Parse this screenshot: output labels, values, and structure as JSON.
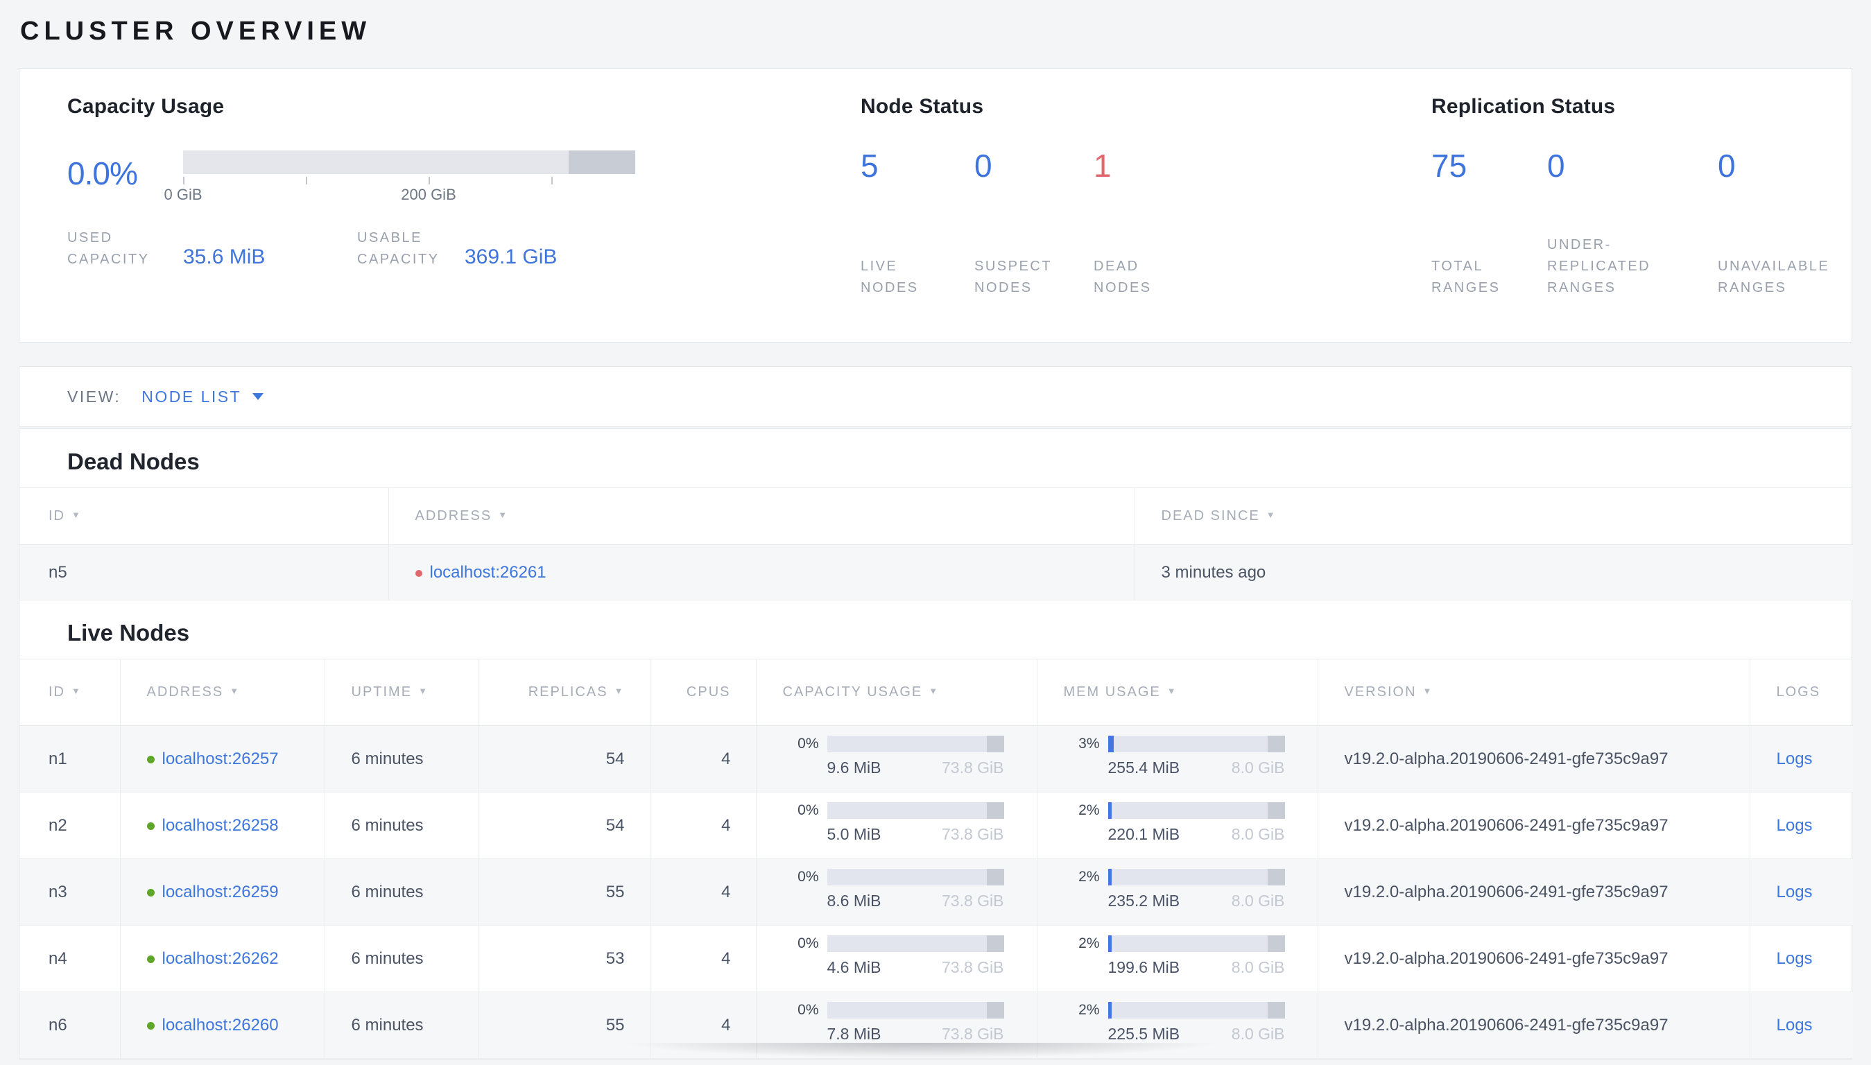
{
  "colors": {
    "accent_blue": "#3e74db",
    "link_blue": "#3d77de",
    "danger_red": "#e0686d",
    "live_green": "#5fa528",
    "bar_track": "#e2e5ee",
    "bar_dark": "#c8ccd4",
    "bar_fill": "#4477e4"
  },
  "page": {
    "title": "CLUSTER OVERVIEW"
  },
  "summary": {
    "capacity": {
      "title": "Capacity Usage",
      "percent": "0.0%",
      "axis_ticks": [
        "0 GiB",
        "200 GiB"
      ],
      "stats": [
        {
          "label": "USED CAPACITY",
          "value": "35.6 MiB"
        },
        {
          "label": "USABLE CAPACITY",
          "value": "369.1 GiB"
        }
      ]
    },
    "node_status": {
      "title": "Node Status",
      "metrics": [
        {
          "value": "5",
          "label": "LIVE NODES",
          "color": "blue"
        },
        {
          "value": "0",
          "label": "SUSPECT NODES",
          "color": "blue"
        },
        {
          "value": "1",
          "label": "DEAD NODES",
          "color": "red"
        }
      ]
    },
    "replication": {
      "title": "Replication Status",
      "metrics": [
        {
          "value": "75",
          "label": "TOTAL RANGES",
          "color": "blue"
        },
        {
          "value": "0",
          "label": "UNDER-REPLICATED RANGES",
          "color": "blue"
        },
        {
          "value": "0",
          "label": "UNAVAILABLE RANGES",
          "color": "blue"
        }
      ]
    }
  },
  "view_bar": {
    "label": "VIEW:",
    "selected": "NODE LIST"
  },
  "dead_nodes": {
    "heading": "Dead Nodes",
    "columns": [
      {
        "label": "ID",
        "sortable": true
      },
      {
        "label": "ADDRESS",
        "sortable": true
      },
      {
        "label": "DEAD SINCE",
        "sortable": true
      }
    ],
    "rows": [
      {
        "id": "n5",
        "address": "localhost:26261",
        "dead_since": "3 minutes ago"
      }
    ]
  },
  "live_nodes": {
    "heading": "Live Nodes",
    "logs_label": "Logs",
    "columns": [
      {
        "label": "ID",
        "sortable": true,
        "align": "left"
      },
      {
        "label": "ADDRESS",
        "sortable": true,
        "align": "left"
      },
      {
        "label": "UPTIME",
        "sortable": true,
        "align": "left"
      },
      {
        "label": "REPLICAS",
        "sortable": true,
        "align": "right"
      },
      {
        "label": "CPUS",
        "sortable": false,
        "align": "right"
      },
      {
        "label": "CAPACITY USAGE",
        "sortable": true,
        "align": "left"
      },
      {
        "label": "MEM USAGE",
        "sortable": true,
        "align": "left"
      },
      {
        "label": "VERSION",
        "sortable": true,
        "align": "left"
      },
      {
        "label": "LOGS",
        "sortable": false,
        "align": "left"
      }
    ],
    "rows": [
      {
        "id": "n1",
        "address": "localhost:26257",
        "uptime": "6 minutes",
        "replicas": "54",
        "cpus": "4",
        "capacity": {
          "percent": "0%",
          "used": "9.6 MiB",
          "total": "73.8 GiB",
          "fill_pct": 0
        },
        "mem": {
          "percent": "3%",
          "used": "255.4 MiB",
          "total": "8.0 GiB",
          "fill_pct": 3
        },
        "version": "v19.2.0-alpha.20190606-2491-gfe735c9a97"
      },
      {
        "id": "n2",
        "address": "localhost:26258",
        "uptime": "6 minutes",
        "replicas": "54",
        "cpus": "4",
        "capacity": {
          "percent": "0%",
          "used": "5.0 MiB",
          "total": "73.8 GiB",
          "fill_pct": 0
        },
        "mem": {
          "percent": "2%",
          "used": "220.1 MiB",
          "total": "8.0 GiB",
          "fill_pct": 2
        },
        "version": "v19.2.0-alpha.20190606-2491-gfe735c9a97"
      },
      {
        "id": "n3",
        "address": "localhost:26259",
        "uptime": "6 minutes",
        "replicas": "55",
        "cpus": "4",
        "capacity": {
          "percent": "0%",
          "used": "8.6 MiB",
          "total": "73.8 GiB",
          "fill_pct": 0
        },
        "mem": {
          "percent": "2%",
          "used": "235.2 MiB",
          "total": "8.0 GiB",
          "fill_pct": 2
        },
        "version": "v19.2.0-alpha.20190606-2491-gfe735c9a97"
      },
      {
        "id": "n4",
        "address": "localhost:26262",
        "uptime": "6 minutes",
        "replicas": "53",
        "cpus": "4",
        "capacity": {
          "percent": "0%",
          "used": "4.6 MiB",
          "total": "73.8 GiB",
          "fill_pct": 0
        },
        "mem": {
          "percent": "2%",
          "used": "199.6 MiB",
          "total": "8.0 GiB",
          "fill_pct": 2
        },
        "version": "v19.2.0-alpha.20190606-2491-gfe735c9a97"
      },
      {
        "id": "n6",
        "address": "localhost:26260",
        "uptime": "6 minutes",
        "replicas": "55",
        "cpus": "4",
        "capacity": {
          "percent": "0%",
          "used": "7.8 MiB",
          "total": "73.8 GiB",
          "fill_pct": 0
        },
        "mem": {
          "percent": "2%",
          "used": "225.5 MiB",
          "total": "8.0 GiB",
          "fill_pct": 2
        },
        "version": "v19.2.0-alpha.20190606-2491-gfe735c9a97"
      }
    ]
  }
}
